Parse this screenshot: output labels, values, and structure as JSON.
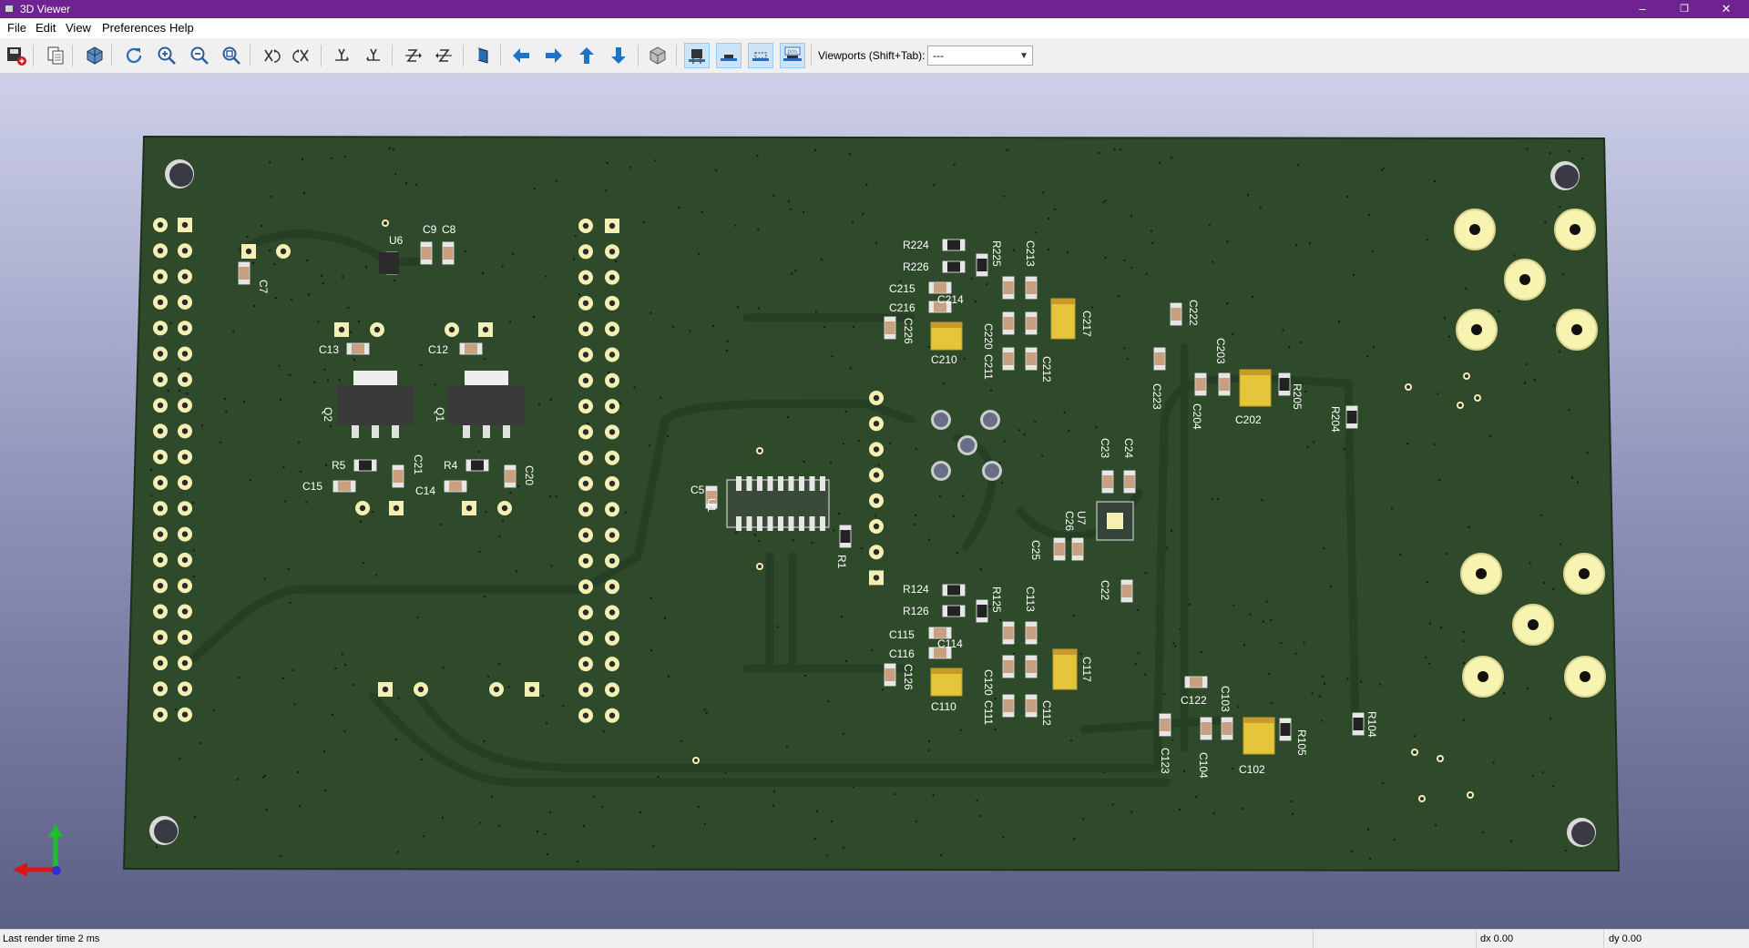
{
  "window": {
    "title": "3D Viewer",
    "controls": [
      "–",
      "❐",
      "✕"
    ]
  },
  "menu": [
    "File",
    "Edit",
    "View",
    "Preferences",
    "Help"
  ],
  "toolbar": {
    "buttons": [
      {
        "name": "export-button",
        "icon": "export-icon"
      },
      {
        "name": "copy-image-button",
        "icon": "copy-icon"
      },
      {
        "name": "raytracing-button",
        "icon": "cube-render-icon"
      },
      {
        "name": "reload-button",
        "icon": "refresh-icon"
      },
      {
        "name": "zoom-in-button",
        "icon": "zoom-in-icon"
      },
      {
        "name": "zoom-out-button",
        "icon": "zoom-out-icon"
      },
      {
        "name": "zoom-fit-button",
        "icon": "zoom-fit-icon"
      },
      {
        "name": "rotate-x-cw-button",
        "icon": "rotate-x-cw-icon"
      },
      {
        "name": "rotate-x-ccw-button",
        "icon": "rotate-x-ccw-icon"
      },
      {
        "name": "rotate-y-cw-button",
        "icon": "rotate-y-cw-icon"
      },
      {
        "name": "rotate-y-ccw-button",
        "icon": "rotate-y-ccw-icon"
      },
      {
        "name": "rotate-z-cw-button",
        "icon": "rotate-z-cw-icon"
      },
      {
        "name": "rotate-z-ccw-button",
        "icon": "rotate-z-ccw-icon"
      },
      {
        "name": "flip-board-button",
        "icon": "flip-board-icon"
      },
      {
        "name": "pan-left-button",
        "icon": "arrow-left-icon"
      },
      {
        "name": "pan-right-button",
        "icon": "arrow-right-icon"
      },
      {
        "name": "pan-up-button",
        "icon": "arrow-up-icon"
      },
      {
        "name": "pan-down-button",
        "icon": "arrow-down-icon"
      },
      {
        "name": "ortho-toggle-button",
        "icon": "ortho-cube-icon"
      },
      {
        "name": "show-tht-button",
        "icon": "tht-icon"
      },
      {
        "name": "show-smd-button",
        "icon": "smd-icon"
      },
      {
        "name": "show-virtual-button",
        "icon": "virtual-icon"
      },
      {
        "name": "show-not-in-pos-button",
        "icon": "not-in-pos-icon",
        "badge": "pos"
      }
    ],
    "viewports_label": "Viewports (Shift+Tab):",
    "viewports_value": "---"
  },
  "board": {
    "colors": {
      "pcb": "#2e4a2b",
      "pad": "#f4f0b4",
      "silk": "#ffffff",
      "trace": "#2a4427"
    },
    "references": {
      "upper_left": [
        "U6",
        "C9",
        "C8",
        "C7",
        "C13",
        "C12",
        "Q2",
        "Q1",
        "R5",
        "R4",
        "C21",
        "C20",
        "C15",
        "C14"
      ],
      "center": [
        "C5",
        "U1",
        "R1"
      ],
      "upper_filter": [
        "R224",
        "R226",
        "R225",
        "C213",
        "C215",
        "C216",
        "C214",
        "C226",
        "C210",
        "C220",
        "C211",
        "C212",
        "C217"
      ],
      "lower_filter": [
        "R124",
        "R126",
        "R125",
        "C113",
        "C115",
        "C116",
        "C114",
        "C126",
        "C110",
        "C120",
        "C111",
        "C112",
        "C117"
      ],
      "power": [
        "C23",
        "C24",
        "U7",
        "C26",
        "C25",
        "C22"
      ],
      "right_upper": [
        "C222",
        "C223",
        "C203",
        "C204",
        "C202",
        "R205",
        "R204"
      ],
      "right_lower": [
        "C122",
        "C103",
        "C123",
        "C104",
        "C102",
        "R105",
        "R104"
      ]
    }
  },
  "axes": {
    "x": "red-axis",
    "y": "green-axis",
    "z": "blue-axis"
  },
  "status": {
    "render": "Last render time 2 ms",
    "dx": "dx 0.00",
    "dy": "dy 0.00"
  }
}
